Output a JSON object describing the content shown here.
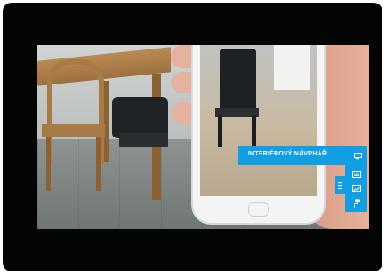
{
  "banner": {
    "label": "INTERIÉROVÝ NÁVRHÁŘ",
    "icon": "monitor-icon"
  },
  "rail_icons": [
    "gallery-icon",
    "image-icon",
    "paint-roller-icon"
  ],
  "menu_icon": "hamburger-menu-icon",
  "colors": {
    "accent": "#129ee3",
    "frame": "#050505",
    "page_background": "#ffffff"
  }
}
